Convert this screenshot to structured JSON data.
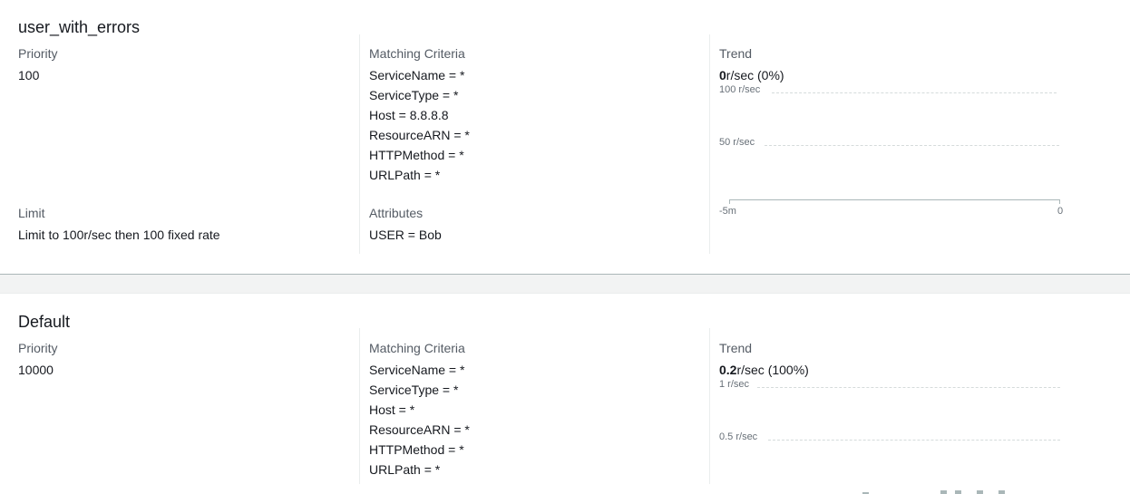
{
  "labels": {
    "priority": "Priority",
    "matching_criteria": "Matching Criteria",
    "trend": "Trend",
    "limit": "Limit",
    "attributes": "Attributes"
  },
  "rules": [
    {
      "name": "user_with_errors",
      "priority": "100",
      "criteria": [
        "ServiceName = *",
        "ServiceType = *",
        "Host = 8.8.8.8",
        "ResourceARN = *",
        "HTTPMethod = *",
        "URLPath = *"
      ],
      "limit": "Limit to 100r/sec then 100 fixed rate",
      "attributes": [
        "USER = Bob"
      ],
      "trend": {
        "rate": "0",
        "rate_suffix": "r/sec (0%)",
        "ytick_top": "100 r/sec",
        "ytick_mid": "50 r/sec",
        "xtick_start": "-5m",
        "xtick_end": "0"
      }
    },
    {
      "name": "Default",
      "priority": "10000",
      "criteria": [
        "ServiceName = *",
        "ServiceType = *",
        "Host = *",
        "ResourceARN = *",
        "HTTPMethod = *",
        "URLPath = *"
      ],
      "trend": {
        "rate": "0.2",
        "rate_suffix": "r/sec (100%)",
        "ytick_top": "1 r/sec",
        "ytick_mid": "0.5 r/sec",
        "bars": [
          0.02,
          0.03,
          0.03,
          0.03,
          0.03
        ]
      }
    }
  ]
}
